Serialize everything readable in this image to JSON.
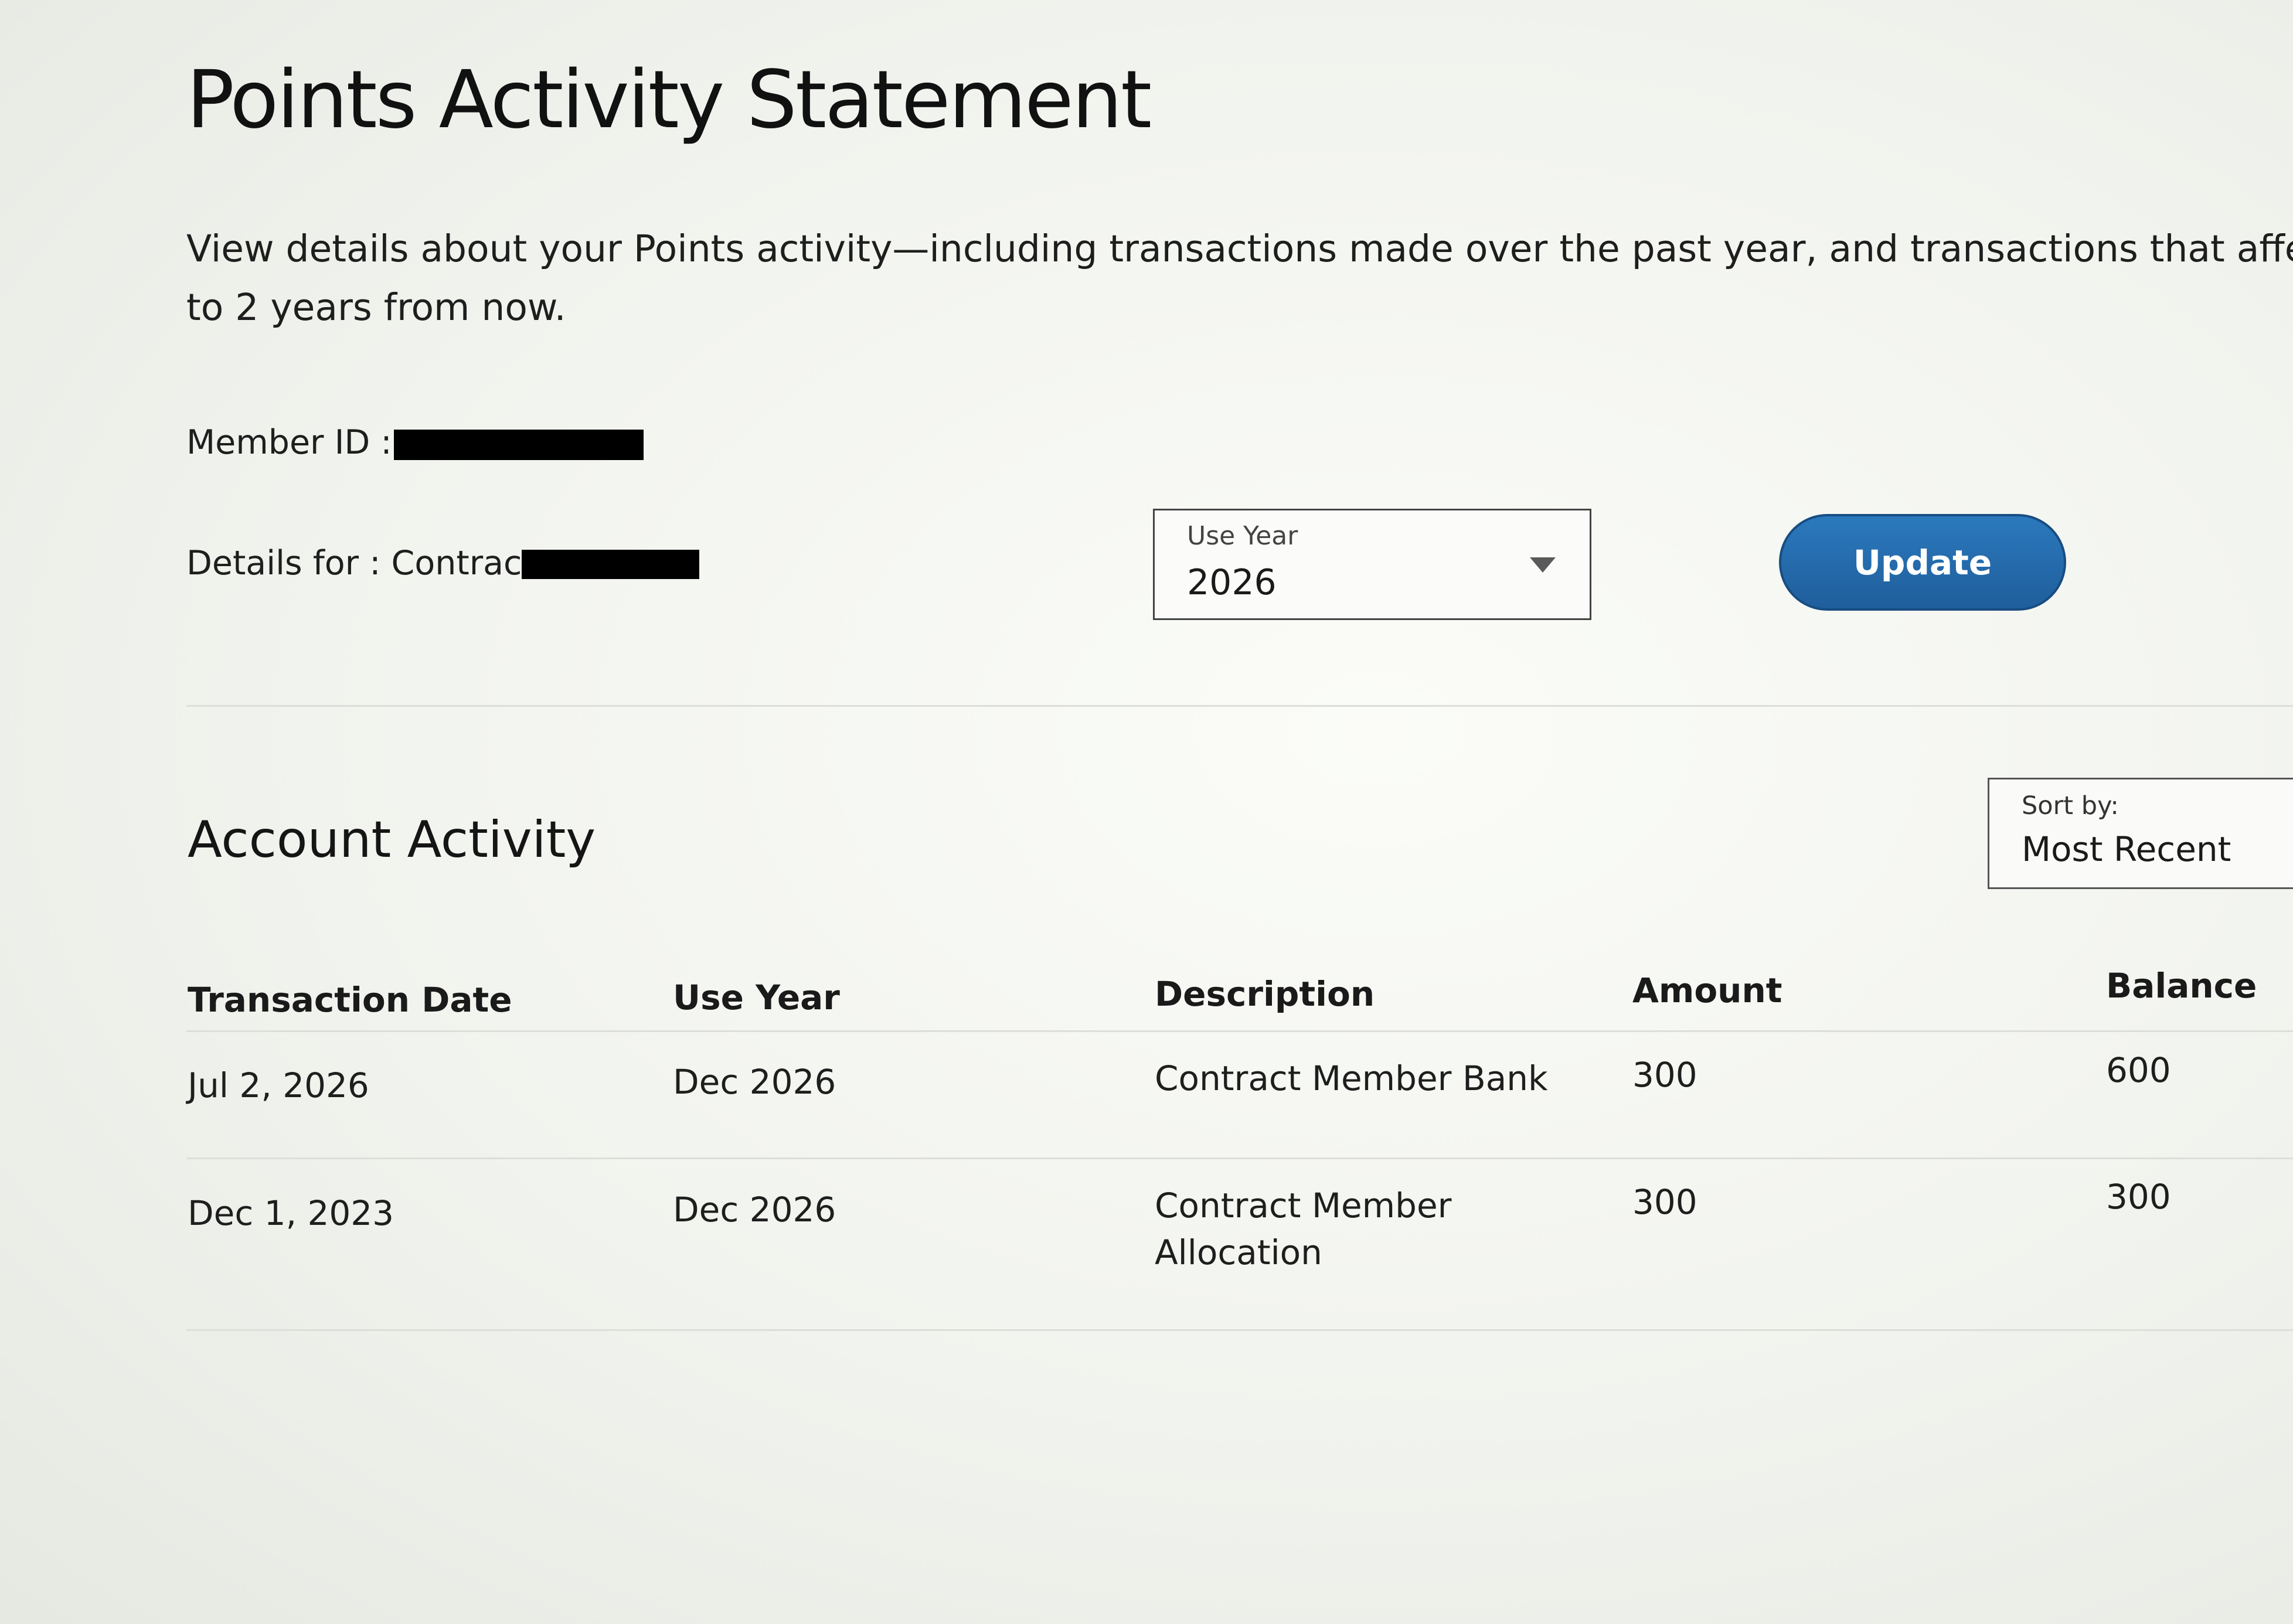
{
  "page": {
    "title": "Points Activity Statement",
    "intro_line1": "View details about your Points activity—including transactions made over the past year, and transactions that affect your N",
    "intro_line2": "to 2 years from now."
  },
  "member": {
    "id_label": "Member ID :",
    "details_label": "Details for : Contract"
  },
  "use_year_select": {
    "label": "Use Year",
    "value": "2026"
  },
  "update_button": {
    "label": "Update"
  },
  "activity": {
    "title": "Account Activity",
    "sort": {
      "label": "Sort by:",
      "value": "Most Recent"
    },
    "columns": [
      "Transaction Date",
      "Use Year",
      "Description",
      "Amount",
      "Balance"
    ],
    "rows": [
      {
        "date": "Jul 2, 2026",
        "use_year": "Dec 2026",
        "description": "Contract Member Bank",
        "amount": "300",
        "balance": "600"
      },
      {
        "date": "Dec 1, 2023",
        "use_year": "Dec 2026",
        "description": "Contract Member Allocation",
        "amount": "300",
        "balance": "300"
      }
    ]
  },
  "colors": {
    "button": "#2670b2",
    "text": "#1c1c1c",
    "redaction": "#000000"
  }
}
